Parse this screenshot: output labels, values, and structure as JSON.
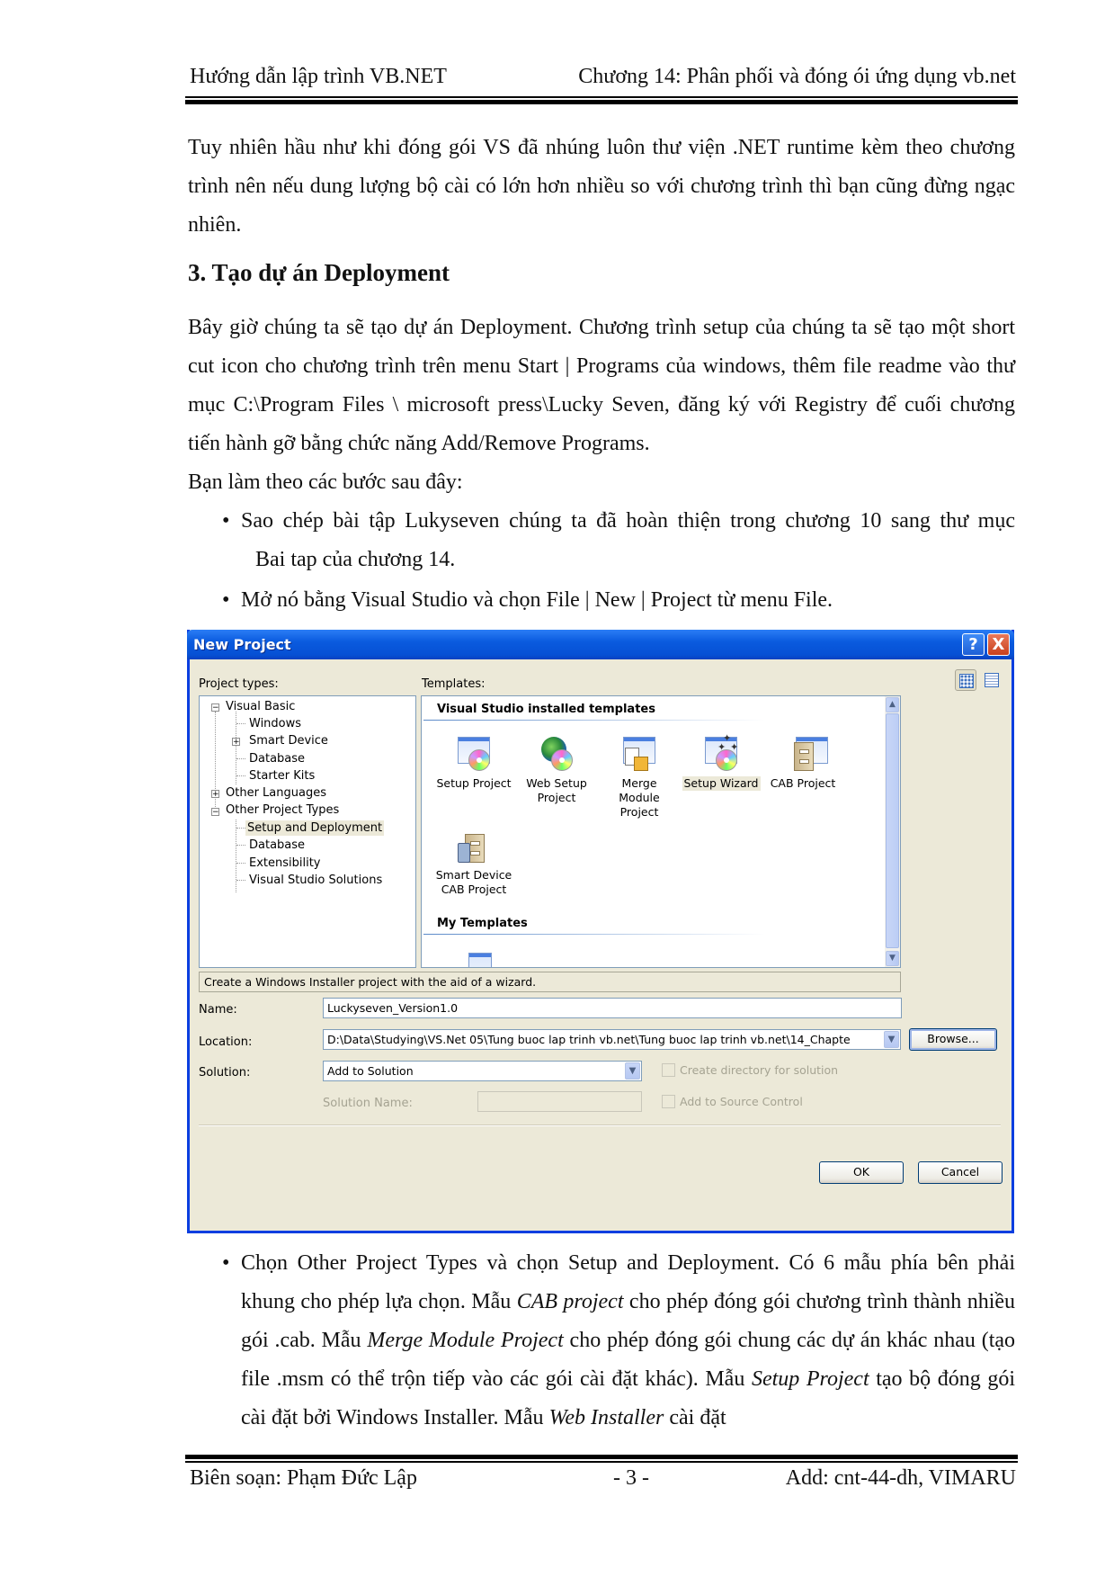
{
  "header": {
    "left": "Hướng dẫn lập trình VB.NET",
    "right": "Chương 14: Phân phối và đóng ói ứng dụng vb.net"
  },
  "body": {
    "intro": "Tuy nhiên hầu như khi đóng gói VS đã nhúng luôn thư viện .NET runtime kèm theo chương trình nên nếu dung lượng bộ cài có lớn hơn nhiều so với chương trình thì bạn cũng đừng ngạc nhiên.",
    "heading": "3. Tạo dự án Deployment",
    "para2": "Bây giờ chúng ta sẽ tạo dự án Deployment. Chương trình setup của chúng ta sẽ tạo một short cut icon cho chương trình trên menu Start | Programs của windows, thêm file readme vào thư mục C:\\Program Files \\ microsoft press\\Lucky Seven, đăng ký với Registry để cuối chương tiến hành gỡ bằng chức năng Add/Remove Programs.",
    "steps_intro": "Bạn làm theo các bước sau đây:",
    "bullets": [
      {
        "line1": "Sao chép bài tập Lukyseven chúng ta đã hoàn thiện trong chương 10 sang thư mục",
        "line2": "Bai tap của chương 14."
      },
      {
        "line1": "Mở nó bằng Visual Studio và chọn File | New | Project từ menu File."
      }
    ],
    "bullet3": {
      "t1": "Chọn Other Project Types và chọn Setup and Deployment. Có 6 mẫu phía bên phải khung cho phép lựa chọn. Mẫu ",
      "i1": "CAB project",
      "t2": " cho phép đóng gói chương trình thành nhiều gói .cab. Mẫu ",
      "i2": "Merge Module Project",
      "t3": " cho phép đóng gói chung các dự án khác nhau (tạo file .msm có thể trộn tiếp vào các gói cài đặt khác). Mẫu ",
      "i3": "Setup Project",
      "t4": " tạo bộ đóng gói cài đặt bởi Windows Installer. Mẫu ",
      "i4": "Web Installer",
      "t5": " cài đặt"
    }
  },
  "dialog": {
    "title": "New Project",
    "help_button": "?",
    "close_button": "X",
    "project_types_label": "Project types:",
    "templates_label": "Templates:",
    "tree": [
      {
        "label": "Visual Basic",
        "level": 0,
        "expander": "minus"
      },
      {
        "label": "Windows",
        "level": 1
      },
      {
        "label": "Smart Device",
        "level": 1,
        "expander": "plus"
      },
      {
        "label": "Database",
        "level": 1
      },
      {
        "label": "Starter Kits",
        "level": 1
      },
      {
        "label": "Other Languages",
        "level": 0,
        "expander": "plus"
      },
      {
        "label": "Other Project Types",
        "level": 0,
        "expander": "minus"
      },
      {
        "label": "Setup and Deployment",
        "level": 1,
        "selected": true
      },
      {
        "label": "Database",
        "level": 1
      },
      {
        "label": "Extensibility",
        "level": 1
      },
      {
        "label": "Visual Studio Solutions",
        "level": 1
      }
    ],
    "installed_group": "Visual Studio installed templates",
    "templates": [
      {
        "label": "Setup Project",
        "icon": "setup-project-icon"
      },
      {
        "label": "Web Setup Project",
        "icon": "web-setup-project-icon"
      },
      {
        "label": "Merge Module Project",
        "icon": "merge-module-icon"
      },
      {
        "label": "Setup Wizard",
        "icon": "setup-wizard-icon",
        "selected": true
      },
      {
        "label": "CAB Project",
        "icon": "cab-project-icon"
      },
      {
        "label": "Smart Device CAB Project",
        "icon": "smart-device-cab-icon"
      }
    ],
    "my_templates_group": "My Templates",
    "description": "Create a Windows Installer project with the aid of a wizard.",
    "name_label": "Name:",
    "name_value": "Luckyseven_Version1.0",
    "location_label": "Location:",
    "location_value": "D:\\Data\\Studying\\VS.Net 05\\Tung buoc lap trinh vb.net\\Tung buoc lap trinh vb.net\\14_Chapte",
    "browse_button": "Browse...",
    "solution_label": "Solution:",
    "solution_value": "Add to Solution",
    "solution_name_label": "Solution Name:",
    "solution_name_value": "",
    "create_dir_label": "Create directory for solution",
    "source_control_label": "Add to Source Control",
    "ok_button": "OK",
    "cancel_button": "Cancel"
  },
  "footer": {
    "left": "Biên soạn: Phạm Đức Lập",
    "center": "- 3 -",
    "right": "Add: cnt-44-dh, VIMARU"
  }
}
